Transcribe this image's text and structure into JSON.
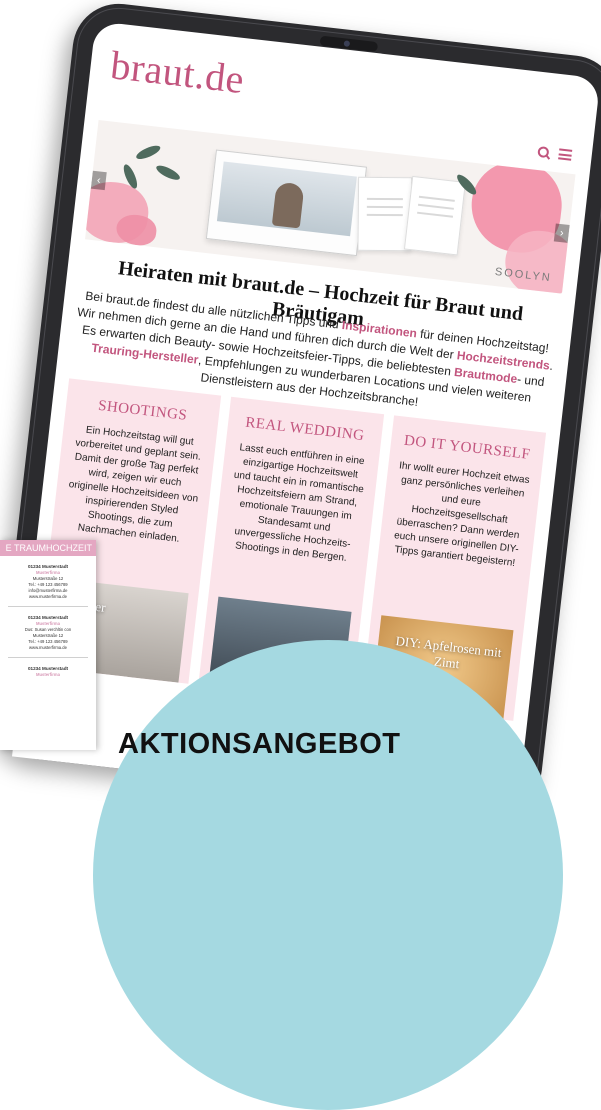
{
  "site": {
    "logo": "braut.de"
  },
  "hero": {
    "brand_tag": "SOOLYN",
    "prev": "‹",
    "next": "›"
  },
  "intro": {
    "heading": "Heiraten mit braut.de – Hochzeit für Braut und Bräutigam",
    "p1": "Bei braut.de findest du alle nützlichen Tipps und ",
    "link_inspirationen": "Inspirationen",
    "p2": " für deinen Hochzeitstag! Wir nehmen dich gerne an die Hand und führen dich durch die Welt der ",
    "link_trends": "Hochzeitstrends",
    "p3": ". Es erwarten dich Beauty- sowie Hochzeitsfeier-Tipps, die beliebtesten ",
    "link_brautmode": "Brautmode",
    "p4": "- und ",
    "link_trauring": "Trauring-Hersteller",
    "p5": ", Empfehlungen zu wunderbaren Locations und vielen weiteren Dienstleistern aus der Hochzeitsbranche!"
  },
  "cards": [
    {
      "title": "SHOOTINGS",
      "text": "Ein Hochzeitstag will gut vorbereitet und geplant sein. Damit der große Tag perfekt wird, zeigen wir euch originelle Hochzeitsideen von inspirierenden Styled Shootings, die zum Nachmachen einladen.",
      "caption": "Summer"
    },
    {
      "title": "REAL WEDDING",
      "text": "Lasst euch entführen in eine einzigartige Hochzeitswelt und taucht ein in romantische Hochzeitsfeiern am Strand, emotionale Trauungen im Standesamt und unvergessliche Hochzeits-Shootings in den Bergen.",
      "caption": ""
    },
    {
      "title": "DO IT YOURSELF",
      "text": "Ihr wollt eurer Hochzeit etwas ganz persönliches verleihen und eure Hochzeitsgesellschaft überraschen? Dann werden euch unsere originellen DIY-Tipps garantiert begeistern!",
      "caption": "DIY: Apfelrosen mit Zimt"
    }
  ],
  "flyer": {
    "banner": "E TRAUMHOCHZEIT",
    "entries": [
      {
        "city": "01234 Musterstadt",
        "firm": "Musterfirma",
        "lines": [
          "Musterstraße 12",
          "Tel.: +49 123 456789",
          "info@musterfirma.de",
          "www.musterfirma.de"
        ]
      },
      {
        "city": "01234 Musterstadt",
        "firm": "Musterfirma",
        "lines": [
          "Dus: Susan verchltin con",
          "Musterstraße 12",
          "Tel.: +49 123 456789",
          "www.musterfirma.de"
        ]
      },
      {
        "city": "01234 Musterstadt",
        "firm": "Musterfirma",
        "lines": []
      }
    ]
  },
  "promo": {
    "headline": "AKTIONSANGEBOT"
  },
  "colors": {
    "brand": "#c2557e",
    "card_bg": "#fbe4ea",
    "promo_bg": "#a5d9e1"
  },
  "icons": [
    "search-icon",
    "menu-icon"
  ]
}
